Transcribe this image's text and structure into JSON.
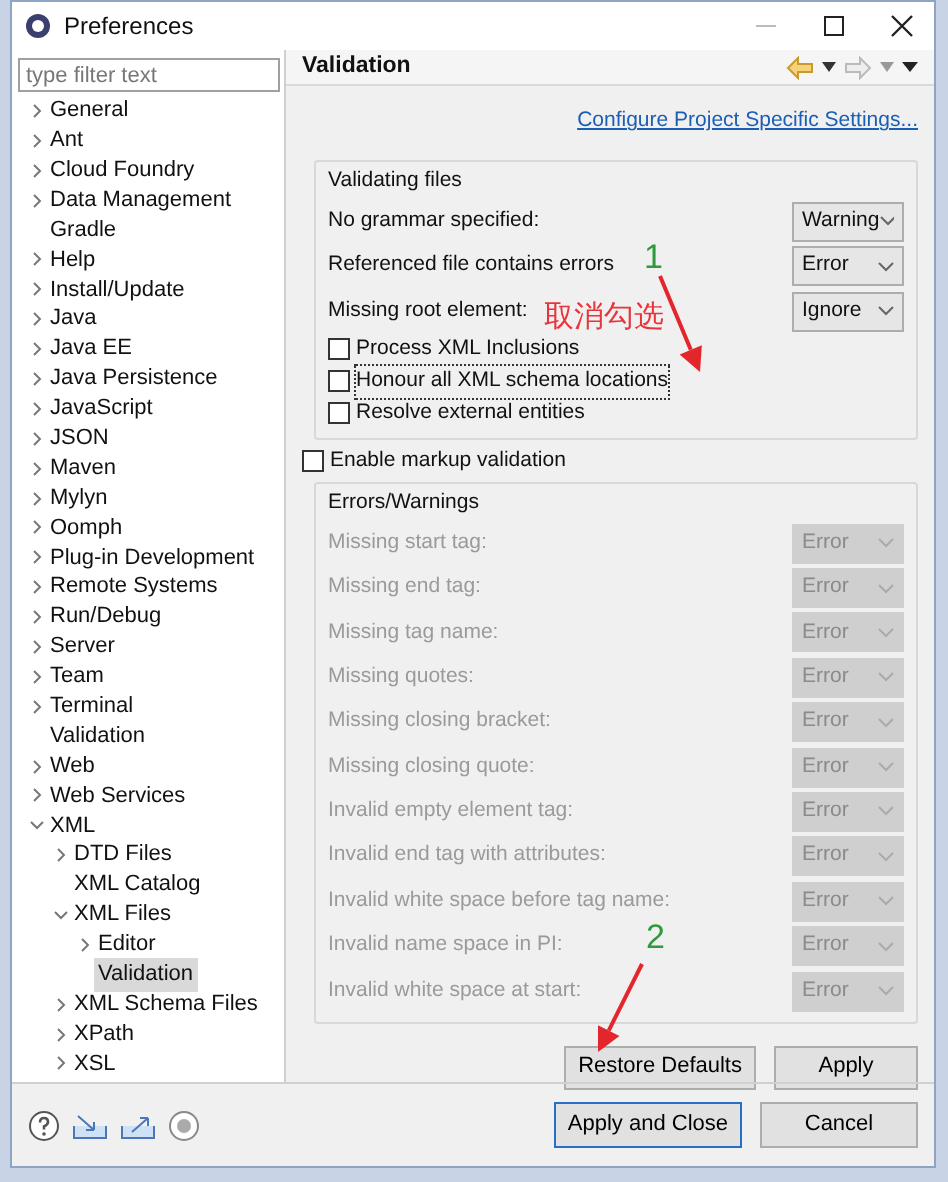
{
  "window": {
    "title": "Preferences"
  },
  "filter": {
    "placeholder": "type filter text"
  },
  "tree": [
    {
      "label": "General",
      "expanded": false,
      "selected": false
    },
    {
      "label": "Ant",
      "expanded": false,
      "selected": false
    },
    {
      "label": "Cloud Foundry",
      "expanded": false,
      "selected": false
    },
    {
      "label": "Data Management",
      "expanded": false,
      "selected": false
    },
    {
      "label": "Gradle",
      "selected": false
    },
    {
      "label": "Help",
      "expanded": false,
      "selected": false
    },
    {
      "label": "Install/Update",
      "expanded": false,
      "selected": false
    },
    {
      "label": "Java",
      "expanded": false,
      "selected": false
    },
    {
      "label": "Java EE",
      "expanded": false,
      "selected": false
    },
    {
      "label": "Java Persistence",
      "expanded": false,
      "selected": false
    },
    {
      "label": "JavaScript",
      "expanded": false,
      "selected": false
    },
    {
      "label": "JSON",
      "expanded": false,
      "selected": false
    },
    {
      "label": "Maven",
      "expanded": false,
      "selected": false
    },
    {
      "label": "Mylyn",
      "expanded": false,
      "selected": false
    },
    {
      "label": "Oomph",
      "expanded": false,
      "selected": false
    },
    {
      "label": "Plug-in Development",
      "expanded": false,
      "selected": false
    },
    {
      "label": "Remote Systems",
      "expanded": false,
      "selected": false
    },
    {
      "label": "Run/Debug",
      "expanded": false,
      "selected": false
    },
    {
      "label": "Server",
      "expanded": false,
      "selected": false
    },
    {
      "label": "Team",
      "expanded": false,
      "selected": false
    },
    {
      "label": "Terminal",
      "expanded": false,
      "selected": false
    },
    {
      "label": "Validation",
      "selected": false
    },
    {
      "label": "Web",
      "expanded": false,
      "selected": false
    },
    {
      "label": "Web Services",
      "expanded": false,
      "selected": false
    },
    {
      "label": "XML",
      "expanded": true,
      "selected": false,
      "children": [
        {
          "label": "DTD Files",
          "expanded": false,
          "selected": false
        },
        {
          "label": "XML Catalog",
          "selected": false
        },
        {
          "label": "XML Files",
          "expanded": true,
          "selected": false,
          "children": [
            {
              "label": "Editor",
              "expanded": false,
              "selected": false
            },
            {
              "label": "Validation",
              "selected": true
            }
          ]
        },
        {
          "label": "XML Schema Files",
          "expanded": false,
          "selected": false
        },
        {
          "label": "XPath",
          "expanded": false,
          "selected": false
        },
        {
          "label": "XSL",
          "expanded": false,
          "selected": false
        }
      ]
    }
  ],
  "page": {
    "title": "Validation",
    "link": "Configure Project Specific Settings...",
    "validating_files": {
      "title": "Validating files",
      "rows": [
        {
          "label": "No grammar specified:",
          "value": "Warning"
        },
        {
          "label": "Referenced file contains errors",
          "value": "Error"
        },
        {
          "label": "Missing root element:",
          "value": "Ignore"
        }
      ],
      "checkboxes": [
        {
          "label": "Process XML Inclusions",
          "checked": false,
          "focused": false
        },
        {
          "label": "Honour all XML schema locations",
          "checked": false,
          "focused": true
        },
        {
          "label": "Resolve external entities",
          "checked": false,
          "focused": false
        }
      ]
    },
    "markup": {
      "label": "Enable markup validation",
      "checked": false
    },
    "errors_warnings": {
      "title": "Errors/Warnings",
      "disabled": true,
      "rows": [
        {
          "label": "Missing start tag:",
          "value": "Error"
        },
        {
          "label": "Missing end tag:",
          "value": "Error"
        },
        {
          "label": "Missing tag name:",
          "value": "Error"
        },
        {
          "label": "Missing quotes:",
          "value": "Error"
        },
        {
          "label": "Missing closing bracket:",
          "value": "Error"
        },
        {
          "label": "Missing closing quote:",
          "value": "Error"
        },
        {
          "label": "Invalid empty element tag:",
          "value": "Error"
        },
        {
          "label": "Invalid end tag with attributes:",
          "value": "Error"
        },
        {
          "label": "Invalid white space before tag name:",
          "value": "Error"
        },
        {
          "label": "Invalid name space in PI:",
          "value": "Error"
        },
        {
          "label": "Invalid white space at start:",
          "value": "Error"
        }
      ]
    },
    "buttons": [
      {
        "label": "Restore Defaults"
      },
      {
        "label": "Apply"
      }
    ]
  },
  "footer_buttons": [
    {
      "label": "Apply and Close",
      "default": true
    },
    {
      "label": "Cancel",
      "default": false
    }
  ],
  "annotations": [
    {
      "kind": "arrow"
    },
    {
      "kind": "label",
      "text": "1",
      "color": "#2e9a3c"
    },
    {
      "kind": "label",
      "text": "取消勾选",
      "color": "#e8343a"
    },
    {
      "kind": "arrow"
    },
    {
      "kind": "label",
      "text": "2",
      "color": "#2e9a3c"
    }
  ]
}
